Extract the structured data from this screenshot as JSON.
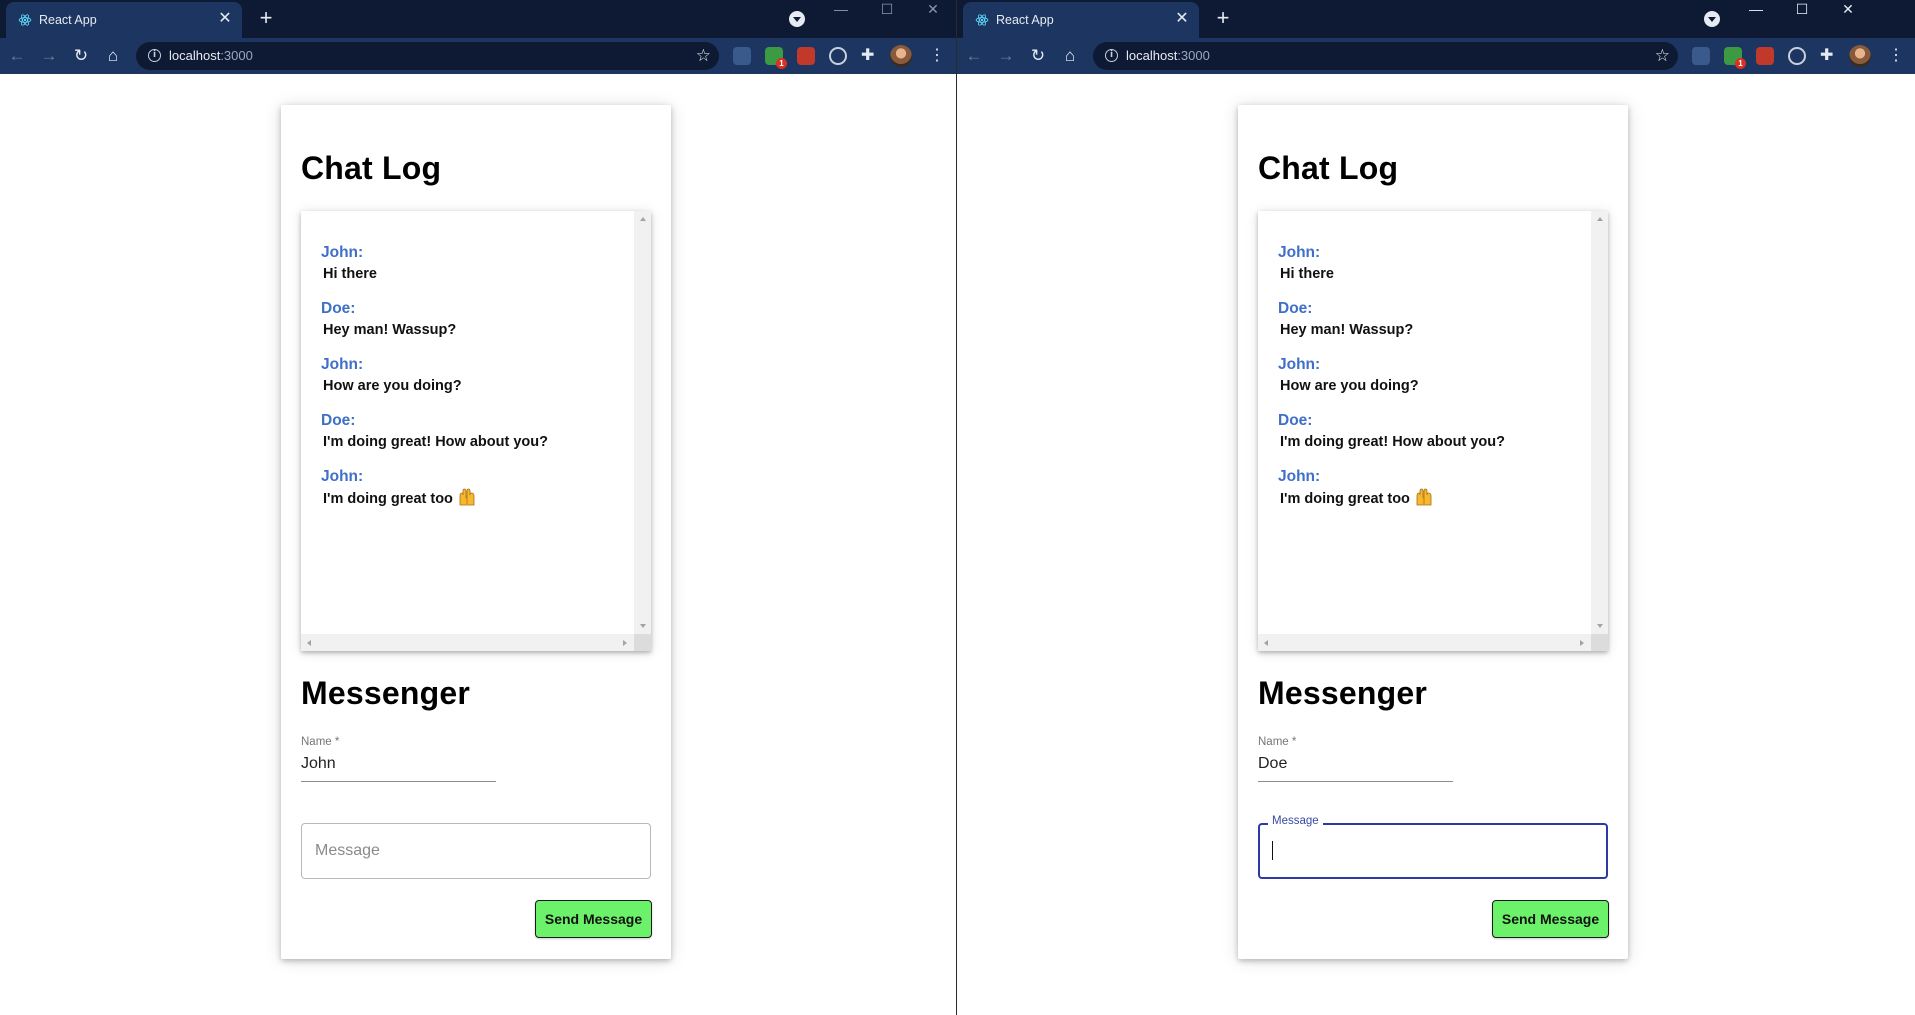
{
  "windows": [
    {
      "tab": {
        "title": "React App"
      },
      "address": {
        "host": "localhost",
        "port": ":3000"
      },
      "chat": {
        "title": "Chat Log",
        "messages": [
          {
            "author": "John:",
            "text": "Hi there"
          },
          {
            "author": "Doe:",
            "text": "Hey man! Wassup?"
          },
          {
            "author": "John:",
            "text": "How are you doing?"
          },
          {
            "author": "Doe:",
            "text": "I'm doing great! How about you?"
          },
          {
            "author": "John:",
            "text": "I'm doing great too",
            "emoji": "raising-hands"
          }
        ]
      },
      "messenger": {
        "title": "Messenger",
        "name_label": "Name *",
        "name_value": "John",
        "message_placeholder": "Message",
        "message_value": "",
        "message_focused": false,
        "send_label": "Send Message"
      },
      "extensions": {
        "badge_count": "1"
      }
    },
    {
      "tab": {
        "title": "React App"
      },
      "address": {
        "host": "localhost",
        "port": ":3000"
      },
      "chat": {
        "title": "Chat Log",
        "messages": [
          {
            "author": "John:",
            "text": "Hi there"
          },
          {
            "author": "Doe:",
            "text": "Hey man! Wassup?"
          },
          {
            "author": "John:",
            "text": "How are you doing?"
          },
          {
            "author": "Doe:",
            "text": "I'm doing great! How about you?"
          },
          {
            "author": "John:",
            "text": "I'm doing great too",
            "emoji": "raising-hands"
          }
        ]
      },
      "messenger": {
        "title": "Messenger",
        "name_label": "Name *",
        "name_value": "Doe",
        "message_label": "Message",
        "message_value": "",
        "message_focused": true,
        "send_label": "Send Message"
      },
      "extensions": {
        "badge_count": "1"
      }
    }
  ],
  "colors": {
    "titlebar": "#0e1a33",
    "toolbar": "#1d3661",
    "author": "#3f6fc7",
    "send_button": "#6cf26a",
    "focus_outline": "#2d3aa6"
  }
}
